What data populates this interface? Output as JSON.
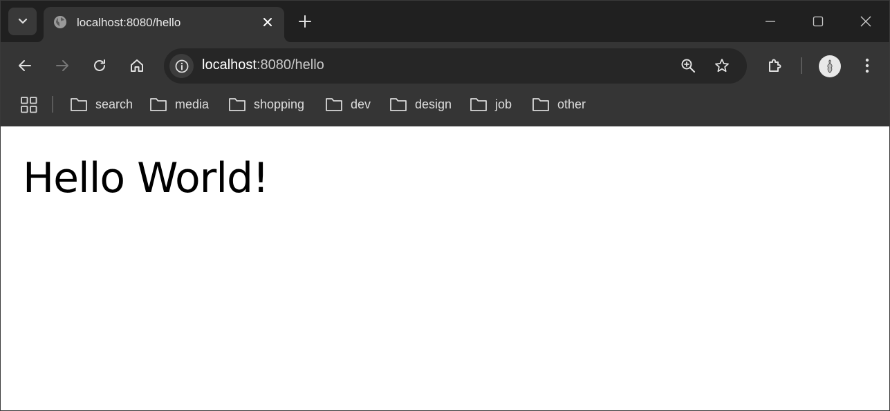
{
  "browser": {
    "tab": {
      "title": "localhost:8080/hello"
    },
    "omnibox": {
      "host": "localhost",
      "path": ":8080/hello"
    },
    "bookmarks": [
      {
        "label": "search"
      },
      {
        "label": "media"
      },
      {
        "label": "shopping"
      },
      {
        "label": "dev"
      },
      {
        "label": "design"
      },
      {
        "label": "job"
      },
      {
        "label": "other"
      }
    ]
  },
  "page": {
    "heading": "Hello World!"
  },
  "colors": {
    "chrome_dark": "#202020",
    "toolbar": "#353535",
    "omnibox": "#262626",
    "page_background": "#ffffff"
  }
}
